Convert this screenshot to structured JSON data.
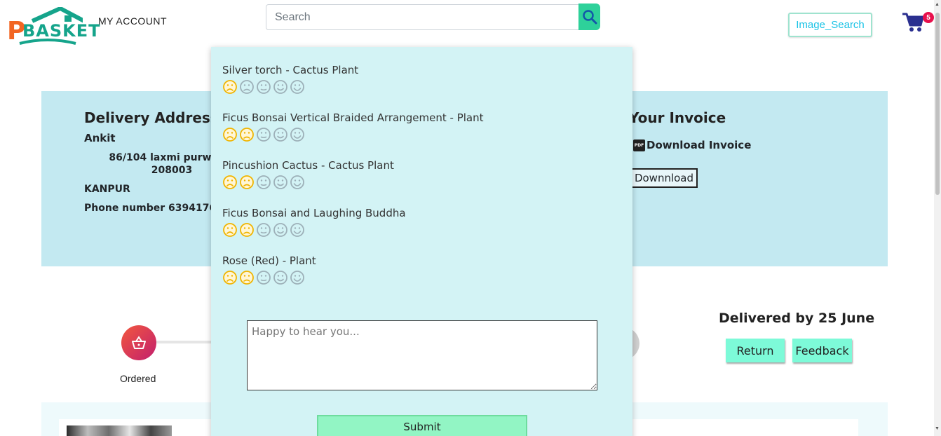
{
  "header": {
    "brand": {
      "initial": "P",
      "name": "BASKET"
    },
    "my_account": "MY ACCOUNT",
    "search_placeholder": "Search",
    "image_search": "Image_Search",
    "cart_count": "5"
  },
  "delivery": {
    "title": "Delivery Address",
    "name": "Ankit",
    "address_line": "86/104 laxmi purwa ka",
    "pincode": "208003",
    "city": "KANPUR",
    "phone": "Phone number 63941765"
  },
  "invoice": {
    "title": "Your Invoice",
    "download_link": "Download Invoice",
    "download_button": "Downnload"
  },
  "tracking": {
    "ordered_label": "Ordered",
    "last_label_partial": "ed",
    "delivered_by": "Delivered by 25 June",
    "return_button": "Return",
    "feedback_button": "Feedback"
  },
  "feedback_modal": {
    "items": [
      {
        "name": "Silver torch - Cactus Plant",
        "rating": 1
      },
      {
        "name": "Ficus Bonsai Vertical Braided Arrangement - Plant",
        "rating": 2
      },
      {
        "name": "Pincushion Cactus - Cactus Plant",
        "rating": 2
      },
      {
        "name": "Ficus Bonsai and Laughing Buddha",
        "rating": 2
      },
      {
        "name": "Rose (Red) - Plant",
        "rating": 2
      }
    ],
    "max_rating": 5,
    "textarea_placeholder": "Happy to hear you...",
    "submit": "Submit"
  },
  "colors": {
    "accent": "#2ed19a",
    "panel": "#c3e9f1",
    "modal": "#d3f3f5",
    "rated_face": "#f0b400",
    "unrated_face": "#9db0b8"
  }
}
